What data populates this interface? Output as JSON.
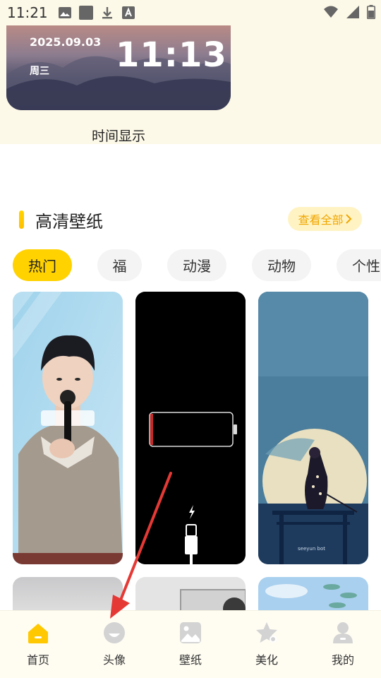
{
  "status_bar": {
    "time": "11:21",
    "left_icons": [
      "image-icon",
      "square-icon",
      "download-icon",
      "text-a-icon"
    ],
    "right_icons": [
      "wifi-icon",
      "signal-icon",
      "battery-icon"
    ]
  },
  "clock_widget": {
    "date": "2025.09.03",
    "weekday": "周三",
    "time": "11:13",
    "label": "时间显示"
  },
  "section": {
    "title": "高清壁纸",
    "view_all": "查看全部",
    "accent_color": "#ffc800"
  },
  "tabs": [
    {
      "label": "热门",
      "active": true
    },
    {
      "label": "福",
      "active": false
    },
    {
      "label": "动漫",
      "active": false
    },
    {
      "label": "动物",
      "active": false
    },
    {
      "label": "个性",
      "active": false
    }
  ],
  "wallpapers": [
    {
      "subject": "young man holding microphone"
    },
    {
      "subject": "low battery charging"
    },
    {
      "subject": "samurai under moon",
      "caption": "seeyun bot"
    },
    {
      "subject": "grey abstract"
    },
    {
      "subject": "frame on wall"
    },
    {
      "subject": "sky with lotus leaves"
    }
  ],
  "bottom_nav": [
    {
      "label": "首页",
      "icon": "home-icon",
      "active": true
    },
    {
      "label": "头像",
      "icon": "avatar-icon",
      "active": false
    },
    {
      "label": "壁纸",
      "icon": "wallpaper-icon",
      "active": false
    },
    {
      "label": "美化",
      "icon": "star-icon",
      "active": false
    },
    {
      "label": "我的",
      "icon": "profile-icon",
      "active": false
    }
  ],
  "colors": {
    "primary_yellow": "#ffd200",
    "nav_inactive": "#cfcfcf",
    "annotation_arrow": "#e53935"
  }
}
